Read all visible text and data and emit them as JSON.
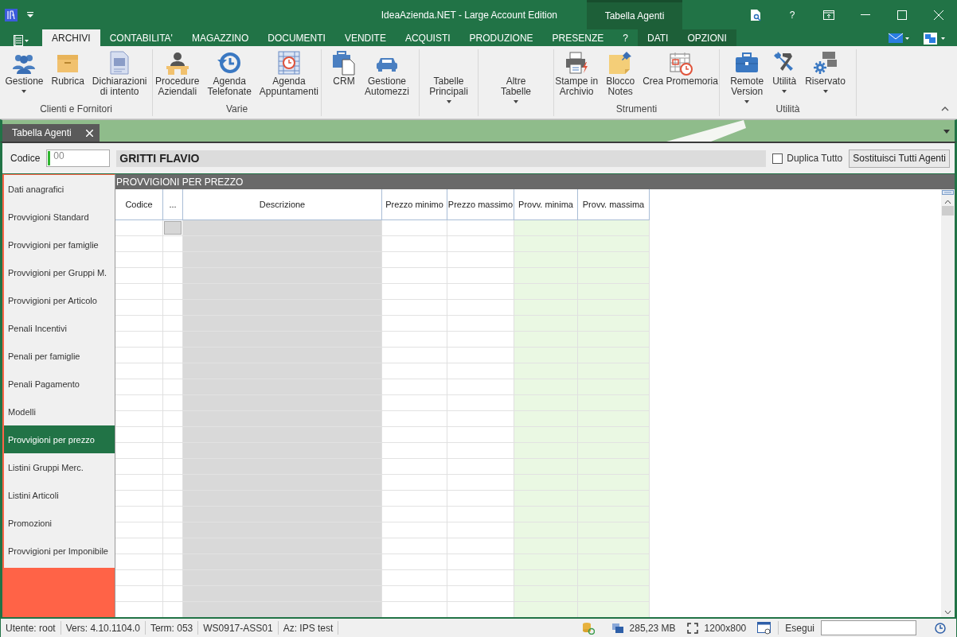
{
  "window": {
    "title": "IdeaAzienda.NET - Large Account Edition",
    "context_group": "Tabella Agenti",
    "help": "?"
  },
  "ribbon_tabs": [
    {
      "label": "ARCHIVI",
      "selected": true,
      "contextual": false
    },
    {
      "label": "CONTABILITA'",
      "selected": false,
      "contextual": false
    },
    {
      "label": "MAGAZZINO",
      "selected": false,
      "contextual": false
    },
    {
      "label": "DOCUMENTI",
      "selected": false,
      "contextual": false
    },
    {
      "label": "VENDITE",
      "selected": false,
      "contextual": false
    },
    {
      "label": "ACQUISTI",
      "selected": false,
      "contextual": false
    },
    {
      "label": "PRODUZIONE",
      "selected": false,
      "contextual": false
    },
    {
      "label": "PRESENZE",
      "selected": false,
      "contextual": false
    },
    {
      "label": "?",
      "selected": false,
      "contextual": false
    },
    {
      "label": "DATI",
      "selected": false,
      "contextual": true
    },
    {
      "label": "OPZIONI",
      "selected": false,
      "contextual": true
    }
  ],
  "ribbon_groups": [
    {
      "label": "Clienti e Fornitori",
      "buttons": [
        {
          "label": "Gestione",
          "dropdown": true
        },
        {
          "label": "Rubrica",
          "dropdown": false
        },
        {
          "label": "Dichiarazioni\ndi intento",
          "dropdown": false
        }
      ]
    },
    {
      "label": "Varie",
      "buttons": [
        {
          "label": "Procedure\nAziendali",
          "dropdown": false
        },
        {
          "label": "Agenda\nTelefonate",
          "dropdown": false
        },
        {
          "label": "Agenda\nAppuntamenti",
          "dropdown": false
        }
      ]
    },
    {
      "buttons": [
        {
          "label": "CRM",
          "dropdown": false
        },
        {
          "label": "Gestione\nAutomezzi",
          "dropdown": false
        }
      ]
    },
    {
      "buttons": [
        {
          "label": "Tabelle\nPrincipali",
          "dropdown": true
        }
      ]
    },
    {
      "buttons": [
        {
          "label": "Altre\nTabelle",
          "dropdown": true
        }
      ]
    },
    {
      "label": "Strumenti",
      "buttons": [
        {
          "label": "Stampe in\nArchivio",
          "dropdown": false
        },
        {
          "label": "Blocco\nNotes",
          "dropdown": false
        },
        {
          "label": "Crea Promemoria",
          "dropdown": false
        }
      ]
    },
    {
      "label": "Utilità",
      "buttons": [
        {
          "label": "Remote\nVersion",
          "dropdown": true
        },
        {
          "label": "Utilità",
          "dropdown": true
        },
        {
          "label": "Riservato",
          "dropdown": true
        }
      ]
    }
  ],
  "document_tabs": [
    {
      "label": "Tabella Agenti",
      "selected": true
    }
  ],
  "form": {
    "code_label": "Codice",
    "code_value": "00",
    "name": "GRITTI FLAVIO",
    "duplicate": {
      "label": "Duplica Tutto",
      "checked": false
    },
    "replace_button": "Sostituisci Tutti Agenti"
  },
  "sidebar": {
    "items": [
      {
        "label": "Dati anagrafici",
        "selected": false
      },
      {
        "label": "Provvigioni Standard",
        "selected": false
      },
      {
        "label": "Provvigioni per famiglie",
        "selected": false
      },
      {
        "label": "Provvigioni per Gruppi M.",
        "selected": false
      },
      {
        "label": "Provvigioni per Articolo",
        "selected": false
      },
      {
        "label": "Penali Incentivi",
        "selected": false
      },
      {
        "label": "Penali per famiglie",
        "selected": false
      },
      {
        "label": "Penali Pagamento",
        "selected": false
      },
      {
        "label": "Modelli",
        "selected": false
      },
      {
        "label": "Provvigioni per prezzo",
        "selected": true
      },
      {
        "label": "Listini Gruppi Merc.",
        "selected": false
      },
      {
        "label": "Listini Articoli",
        "selected": false
      },
      {
        "label": "Promozioni",
        "selected": false
      },
      {
        "label": "Provvigioni per Imponibile",
        "selected": false
      }
    ]
  },
  "table": {
    "title": "PROVVIGIONI PER PREZZO",
    "columns": [
      "Codice",
      "...",
      "Descrizione",
      "Prezzo minimo",
      "Prezzo massimo",
      "Provv. minima",
      "Provv. massima"
    ]
  },
  "status_bar": {
    "items": [
      "Utente: root",
      "Vers: 4.10.1104.0",
      "Term: 053",
      "WS0917-ASS01",
      "Az: IPS test"
    ],
    "memory": "285,23 MB",
    "resolution": "1200x800",
    "run_label": "Esegui"
  }
}
